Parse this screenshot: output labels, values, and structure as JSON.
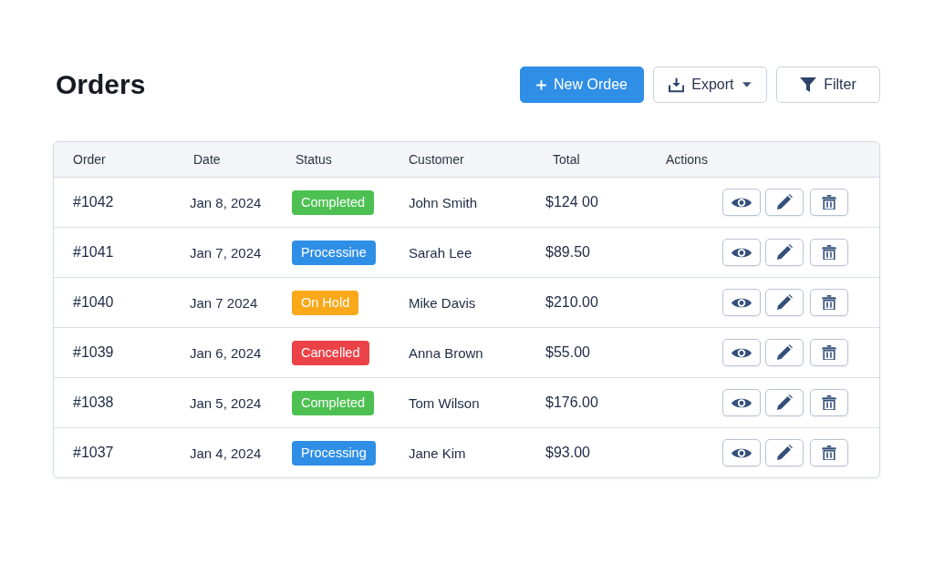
{
  "page": {
    "title": "Orders"
  },
  "toolbar": {
    "buttons": [
      {
        "kind": "add",
        "label": "New Ordee"
      },
      {
        "kind": "export",
        "label": "Export"
      },
      {
        "kind": "filter",
        "label": "Filter"
      }
    ]
  },
  "table": {
    "columns": [
      "Order",
      "Date",
      "Status",
      "Customer",
      "Total",
      "Actions"
    ],
    "rows": [
      {
        "order": "#1042",
        "date": "Jan 8, 2024",
        "status": {
          "label": "Completed",
          "color": "#4cc152"
        },
        "customer": "John Smith",
        "total": "$124 00"
      },
      {
        "order": "#1041",
        "date": "Jan 7, 2024",
        "status": {
          "label": "Processine",
          "color": "#2f8fe6"
        },
        "customer": "Sarah Lee",
        "total": "$89.50"
      },
      {
        "order": "#1040",
        "date": "Jan 7 2024",
        "status": {
          "label": "On Hold",
          "color": "#f9a81a"
        },
        "customer": "Mike Davis",
        "total": "$210.00"
      },
      {
        "order": "#1039",
        "date": "Jan 6, 2024",
        "status": {
          "label": "Cancelled",
          "color": "#eb4248"
        },
        "customer": "Anna Brown",
        "total": "$55.00"
      },
      {
        "order": "#1038",
        "date": "Jan 5, 2024",
        "status": {
          "label": "Completed",
          "color": "#4cc152"
        },
        "customer": "Tom Wilson",
        "total": "$176.00"
      },
      {
        "order": "#1037",
        "date": "Jan 4, 2024",
        "status": {
          "label": "Processing",
          "color": "#2f8fe6"
        },
        "customer": "Jane Kim",
        "total": "$93.00"
      }
    ]
  }
}
